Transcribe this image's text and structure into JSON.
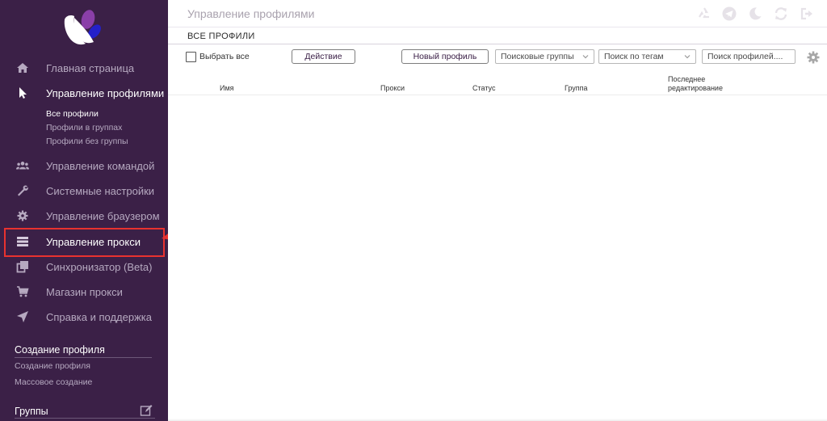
{
  "sidebar": {
    "items": [
      {
        "label": "Главная страница",
        "icon": "home-icon"
      },
      {
        "label": "Управление профилями",
        "icon": "pointer-icon"
      },
      {
        "label": "Управление командой",
        "icon": "users-icon"
      },
      {
        "label": "Системные настройки",
        "icon": "wrench-icon"
      },
      {
        "label": "Управление браузером",
        "icon": "gear-icon"
      },
      {
        "label": "Управление прокси",
        "icon": "server-icon"
      },
      {
        "label": "Синхронизатор (Beta)",
        "icon": "copy-icon"
      },
      {
        "label": "Магазин прокси",
        "icon": "cart-icon"
      },
      {
        "label": "Справка и поддержка",
        "icon": "paper-plane-icon"
      }
    ],
    "profile_subitems": [
      "Все профили",
      "Профили в группах",
      "Профили без группы"
    ],
    "create_section": {
      "title": "Создание профиля",
      "links": [
        "Создание профиля",
        "Массовое создание"
      ]
    },
    "groups_title": "Группы"
  },
  "header": {
    "title": "Управление профилями"
  },
  "subheader": {
    "title": "ВСЕ ПРОФИЛИ"
  },
  "toolbar": {
    "select_all": "Выбрать все",
    "action_button": "Действие",
    "new_profile_button": "Новый профиль",
    "search_groups": "Поисковые группы",
    "search_tags": "Поиск по тегам",
    "search_profiles_placeholder": "Поиск профилей...."
  },
  "table": {
    "columns": [
      "Имя",
      "Прокси",
      "Статус",
      "Группа",
      "Последнее",
      "редактирование"
    ]
  },
  "colors": {
    "sidebar_bg": "#3b2047",
    "highlight": "#e8322f",
    "accent_purple": "#8a3fa8",
    "accent_blue": "#2420c9"
  }
}
